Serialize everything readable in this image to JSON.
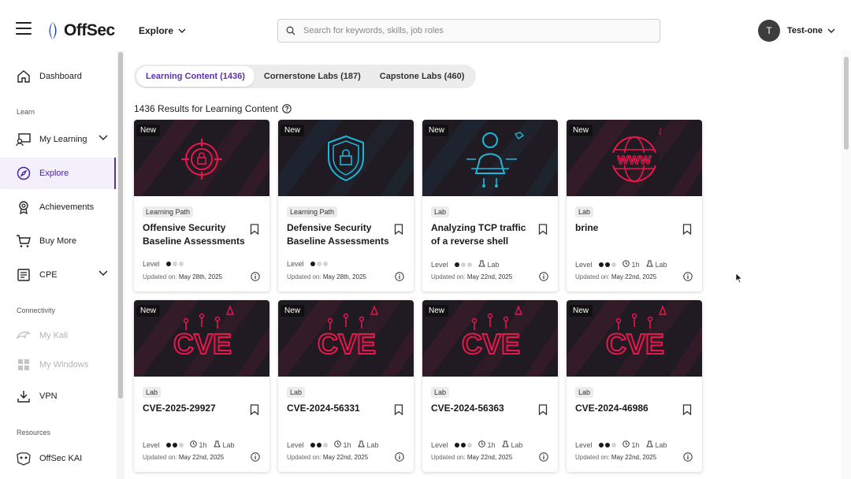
{
  "header": {
    "logo_text": "OffSec",
    "explore_label": "Explore",
    "search_placeholder": "Search for keywords, skills, job roles",
    "user_initial": "T",
    "user_name": "Test-one"
  },
  "sidebar": {
    "dashboard": "Dashboard",
    "section_learn": "Learn",
    "my_learning": "My Learning",
    "explore": "Explore",
    "achievements": "Achievements",
    "buy_more": "Buy More",
    "cpe": "CPE",
    "section_connectivity": "Connectivity",
    "my_kali": "My Kali",
    "my_windows": "My Windows",
    "vpn": "VPN",
    "section_resources": "Resources",
    "offsec_kai": "OffSec KAI"
  },
  "tabs": [
    {
      "label": "Learning Content (1436)",
      "active": true
    },
    {
      "label": "Cornerstone Labs (187)",
      "active": false
    },
    {
      "label": "Capstone Labs (460)",
      "active": false
    }
  ],
  "results_label": "1436 Results for Learning Content",
  "labels": {
    "level": "Level",
    "updated_on": "Updated on:",
    "new": "New"
  },
  "cards": [
    {
      "type": "Learning Path",
      "title": "Offensive Security Baseline Assessments",
      "level": 1,
      "duration": "",
      "kind": "",
      "updated": "May 28th, 2025",
      "art": "target-icon"
    },
    {
      "type": "Learning Path",
      "title": "Defensive Security Baseline Assessments",
      "level": 1,
      "duration": "",
      "kind": "",
      "updated": "May 28th, 2025",
      "art": "shield-icon"
    },
    {
      "type": "Lab",
      "title": "Analyzing TCP traffic of a reverse shell wit…",
      "level": 1,
      "duration": "",
      "kind": "Lab",
      "updated": "May 22nd, 2025",
      "art": "hacker-icon"
    },
    {
      "type": "Lab",
      "title": "brine",
      "level": 2,
      "duration": "1h",
      "kind": "Lab",
      "updated": "May 22nd, 2025",
      "art": "www-globe-icon"
    },
    {
      "type": "Lab",
      "title": "CVE-2025-29927",
      "level": 2,
      "duration": "1h",
      "kind": "Lab",
      "updated": "May 22nd, 2025",
      "art": "cve-icon"
    },
    {
      "type": "Lab",
      "title": "CVE-2024-56331",
      "level": 2,
      "duration": "1h",
      "kind": "Lab",
      "updated": "May 22nd, 2025",
      "art": "cve-icon"
    },
    {
      "type": "Lab",
      "title": "CVE-2024-56363",
      "level": 2,
      "duration": "1h",
      "kind": "Lab",
      "updated": "May 22nd, 2025",
      "art": "cve-icon"
    },
    {
      "type": "Lab",
      "title": "CVE-2024-46986",
      "level": 2,
      "duration": "1h",
      "kind": "Lab",
      "updated": "May 22nd, 2025",
      "art": "cve-icon"
    }
  ],
  "colors": {
    "accent": "#5b2fb5",
    "card_art_red": "#e8174d",
    "card_art_cyan": "#1fb6d9"
  }
}
